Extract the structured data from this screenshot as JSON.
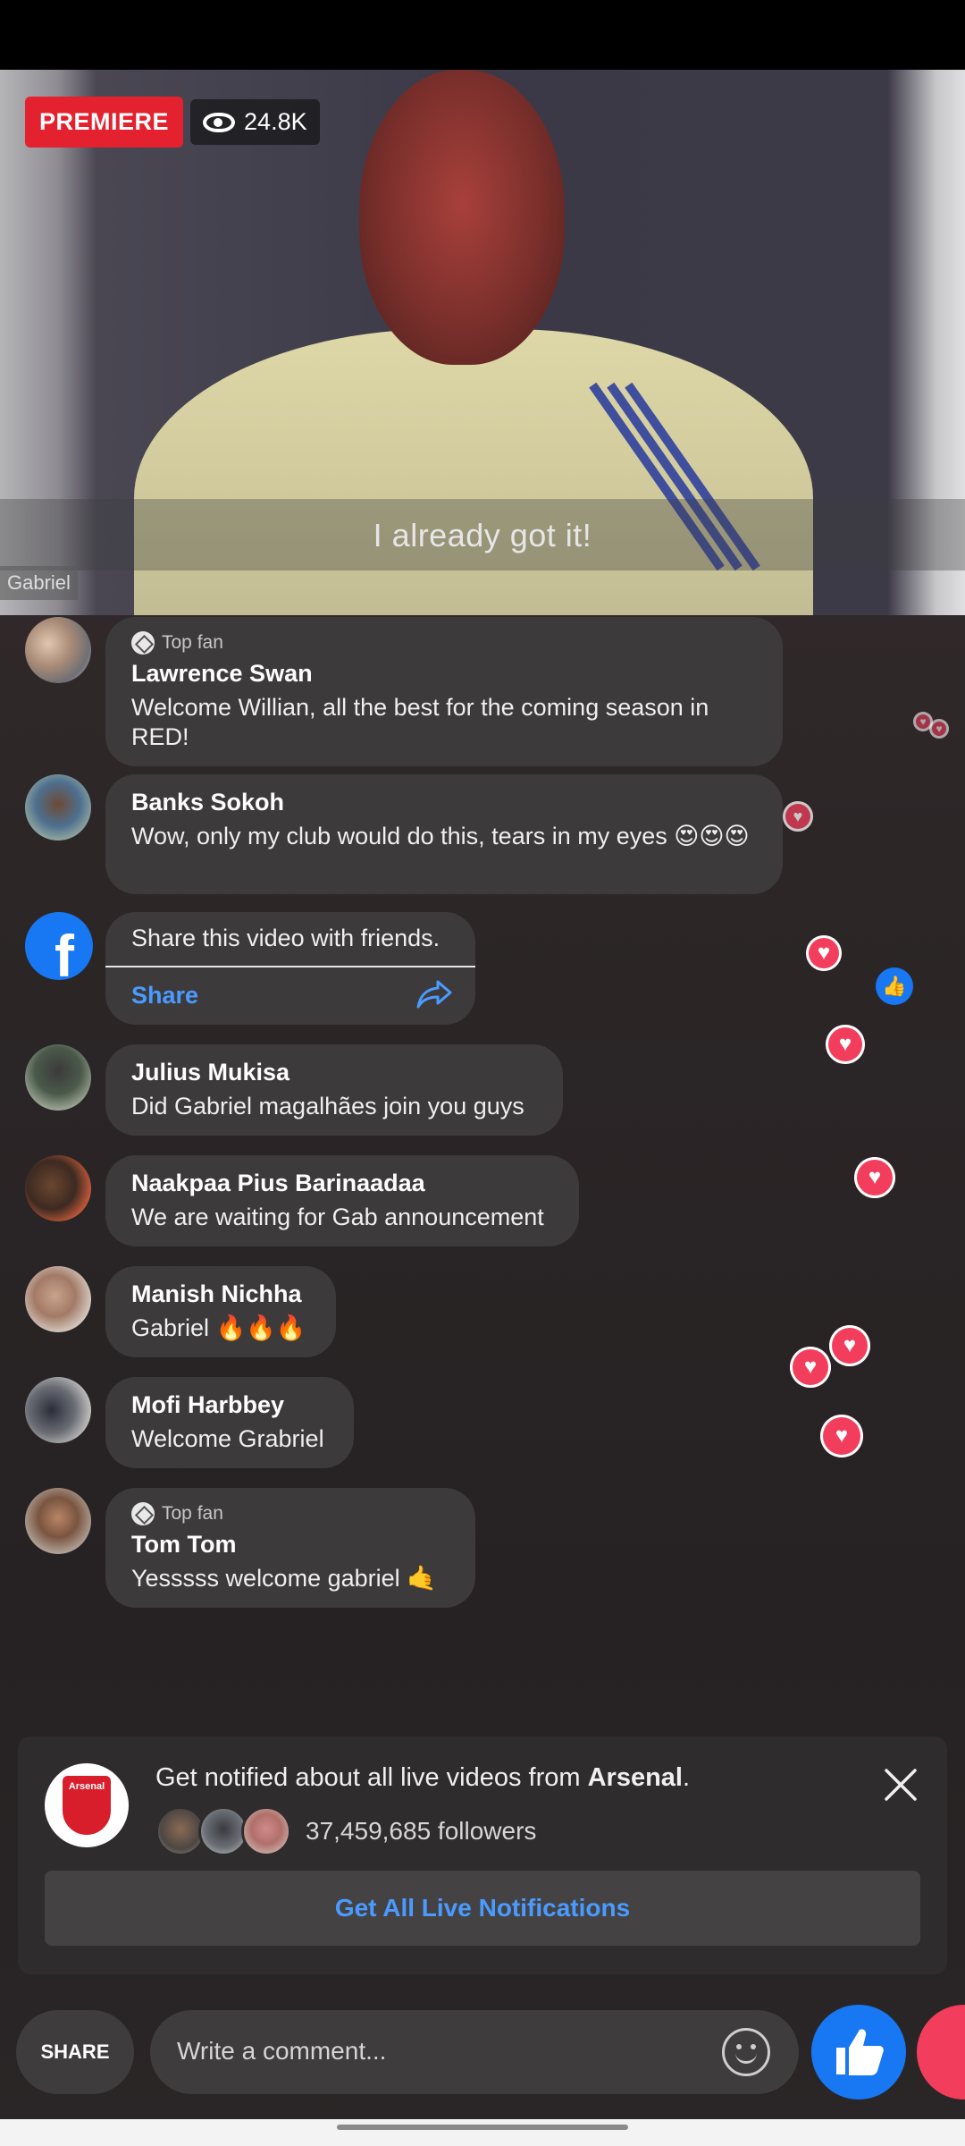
{
  "video": {
    "badge": "PREMIERE",
    "views": "24.8K",
    "caption": "I already got it!",
    "name_tag": "Gabriel"
  },
  "comments": [
    {
      "top_fan": true,
      "top_fan_label": "Top fan",
      "name": "Lawrence Swan",
      "text": "Welcome Willian, all the best for the coming season in RED!"
    },
    {
      "top_fan": false,
      "name": "Banks Sokoh",
      "text": "Wow, only my club would do this, tears in my eyes 😍😍😍"
    },
    {
      "top_fan": false,
      "name": "Julius Mukisa",
      "text": "Did Gabriel magalhães join you guys"
    },
    {
      "top_fan": false,
      "name": "Naakpaa Pius Barinaadaa",
      "text": "We are waiting for Gab announcement"
    },
    {
      "top_fan": false,
      "name": "Manish Nichha",
      "text": "Gabriel 🔥🔥🔥"
    },
    {
      "top_fan": false,
      "name": "Mofi Harbbey",
      "text": "Welcome Grabriel"
    },
    {
      "top_fan": true,
      "top_fan_label": "Top fan",
      "name": "Tom Tom",
      "text": "Yesssss welcome gabriel 🤙"
    }
  ],
  "share_card": {
    "text": "Share this video with friends.",
    "link": "Share"
  },
  "notification": {
    "message_prefix": "Get notified about all live videos from ",
    "page_name": "Arsenal",
    "message_suffix": ".",
    "followers": "37,459,685 followers",
    "cta": "Get All Live Notifications",
    "logo_text": "Arsenal"
  },
  "bottom_bar": {
    "share": "SHARE",
    "comment_placeholder": "Write a comment..."
  },
  "colors": {
    "premiere": "#e4212f",
    "facebook_blue": "#1877f2",
    "love": "#f23e5c",
    "link": "#4a9bff"
  }
}
